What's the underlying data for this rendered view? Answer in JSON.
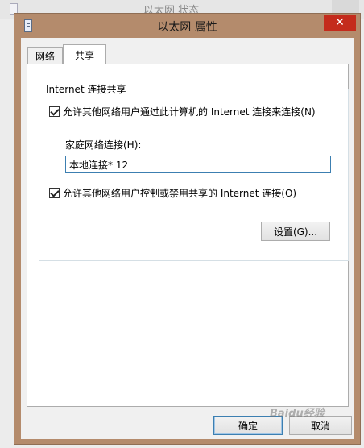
{
  "background_window": {
    "title": "以太网 状态"
  },
  "dialog": {
    "title": "以太网 属性",
    "close_glyph": "✕"
  },
  "tabs": [
    {
      "label": "网络",
      "active": false
    },
    {
      "label": "共享",
      "active": true
    }
  ],
  "sharing": {
    "group_title": "Internet 连接共享",
    "allow_share_label": "允许其他网络用户通过此计算机的 Internet 连接来连接(N)",
    "allow_share_checked": true,
    "home_network_label": "家庭网络连接(H):",
    "home_network_value": "本地连接* 12",
    "allow_control_label": "允许其他网络用户控制或禁用共享的 Internet 连接(O)",
    "allow_control_checked": true,
    "settings_button": "设置(G)..."
  },
  "footer": {
    "ok_label": "确定",
    "cancel_label": "取消"
  },
  "watermark": "Baidu经验",
  "colors": {
    "titlebar": "#b48b6c",
    "close_button": "#c42b1c",
    "input_border": "#3c7fb1"
  }
}
